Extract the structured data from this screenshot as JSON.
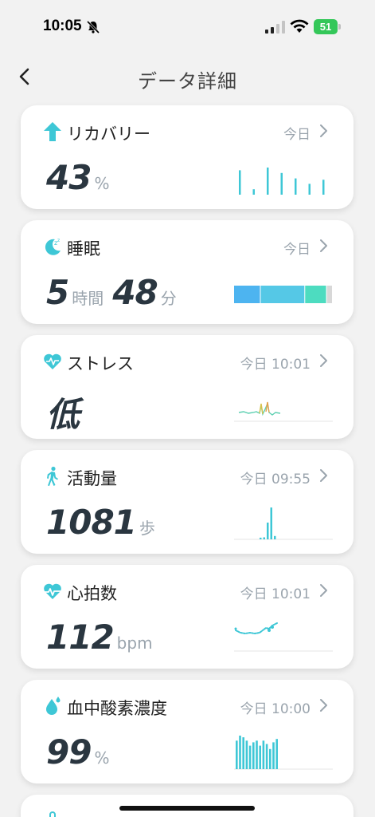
{
  "status_bar": {
    "time": "10:05",
    "battery": "51"
  },
  "header": {
    "title": "データ詳細"
  },
  "colors": {
    "accent": "#3ec7d6",
    "value": "#2a3640",
    "muted": "#9aa4ad",
    "battery": "#34c759"
  },
  "cards": [
    {
      "icon": "arrow-up-icon",
      "title": "リカバリー",
      "time": "今日",
      "value": "43",
      "unit": "%",
      "bars": [
        0.9,
        0.2,
        1.0,
        0.8,
        0.6,
        0.4,
        0.55
      ]
    },
    {
      "icon": "moon-zzz-icon",
      "title": "睡眠",
      "time": "今日",
      "hours": "5",
      "hours_unit": "時間",
      "minutes": "48",
      "minutes_unit": "分",
      "stages": [
        {
          "name": "deep",
          "color": "#4db4f0",
          "fraction": 0.27
        },
        {
          "name": "light",
          "color": "#55c8e6",
          "fraction": 0.45
        },
        {
          "name": "rem",
          "color": "#4ddcc0",
          "fraction": 0.22
        },
        {
          "name": "awake",
          "color": "#d8d8d8",
          "fraction": 0.06
        }
      ]
    },
    {
      "icon": "heart-pulse-icon",
      "title": "ストレス",
      "time": "今日 10:01",
      "value": "低"
    },
    {
      "icon": "walking-icon",
      "title": "活動量",
      "time": "今日 09:55",
      "value": "1081",
      "unit": "歩",
      "bars": [
        0.05,
        0.06,
        0.5,
        0.95,
        0.1
      ]
    },
    {
      "icon": "heart-rate-icon",
      "title": "心拍数",
      "time": "今日 10:01",
      "value": "112",
      "unit": "bpm"
    },
    {
      "icon": "water-drop-icon",
      "title": "血中酸素濃度",
      "time": "今日 10:00",
      "value": "99",
      "unit": "%",
      "bars": [
        0.85,
        1.0,
        0.95,
        0.85,
        0.7,
        0.8,
        0.85,
        0.7,
        0.85,
        0.75,
        0.6,
        0.8,
        0.9
      ]
    }
  ]
}
